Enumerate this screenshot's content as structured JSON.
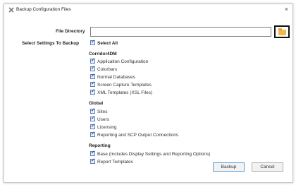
{
  "window": {
    "title": "Backup Configuration Files",
    "icon": "tools-icon",
    "close": "×"
  },
  "file_directory": {
    "label": "File Directory",
    "value": "",
    "browse_icon": "folder-icon"
  },
  "select_settings_label": "Select Settings To Backup",
  "select_all": {
    "label": "Select All",
    "checked": true
  },
  "groups": [
    {
      "title": "Corridor4DM",
      "items": [
        {
          "label": "Application Configuration",
          "checked": true
        },
        {
          "label": "Colorbars",
          "checked": true
        },
        {
          "label": "Normal Databases",
          "checked": true
        },
        {
          "label": "Screen Capture Templates",
          "checked": true
        },
        {
          "label": "XML Templates (XSL Files)",
          "checked": true
        }
      ]
    },
    {
      "title": "Global",
      "items": [
        {
          "label": "Sites",
          "checked": true
        },
        {
          "label": "Users",
          "checked": true
        },
        {
          "label": "Licensing",
          "checked": true
        },
        {
          "label": "Reporting and SCP Output Connections",
          "checked": true
        }
      ]
    },
    {
      "title": "Reporting",
      "items": [
        {
          "label": "Base (Includes Display Settings and Reporting Options)",
          "checked": true
        },
        {
          "label": "Report Templates",
          "checked": true
        }
      ]
    }
  ],
  "buttons": {
    "backup": "Backup",
    "cancel": "Cancel"
  },
  "colors": {
    "checkbox_border": "#5a7ebd",
    "folder": "#f2b84a",
    "primary_border": "#5a9ad8"
  }
}
